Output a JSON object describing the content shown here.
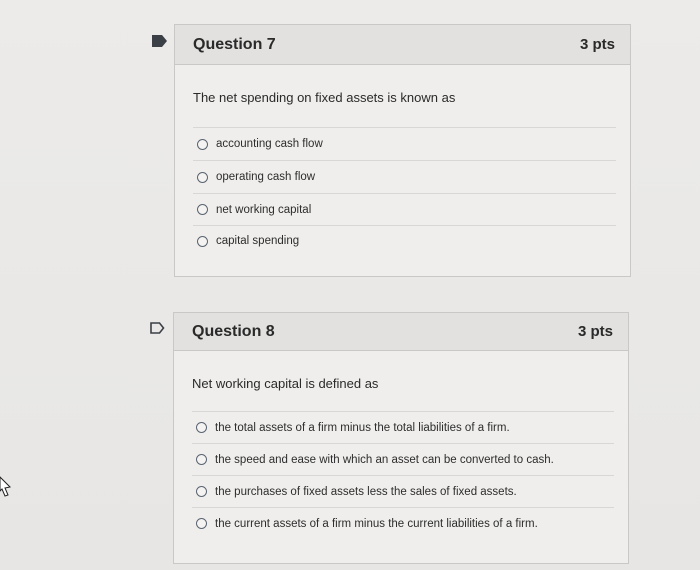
{
  "questions": [
    {
      "title": "Question 7",
      "points": "3 pts",
      "text": "The net spending on fixed assets is known as",
      "flag_icon": "bookmark-filled-icon",
      "answers": [
        "accounting cash flow",
        "operating cash flow",
        "net working capital",
        "capital spending"
      ]
    },
    {
      "title": "Question 8",
      "points": "3 pts",
      "text": "Net working capital is defined as",
      "flag_icon": "bookmark-outline-icon",
      "answers": [
        "the total assets of a firm minus the total liabilities of a firm.",
        "the speed and ease with which an asset can be converted to cash.",
        "the purchases of fixed assets less the sales of fixed assets.",
        "the current assets of a firm minus the current liabilities of a firm."
      ]
    }
  ],
  "colors": {
    "flag_filled": "#3b3f46",
    "header_bg": "#e2e1df",
    "panel_bg": "#efeeec",
    "border": "#c9c8c6"
  }
}
